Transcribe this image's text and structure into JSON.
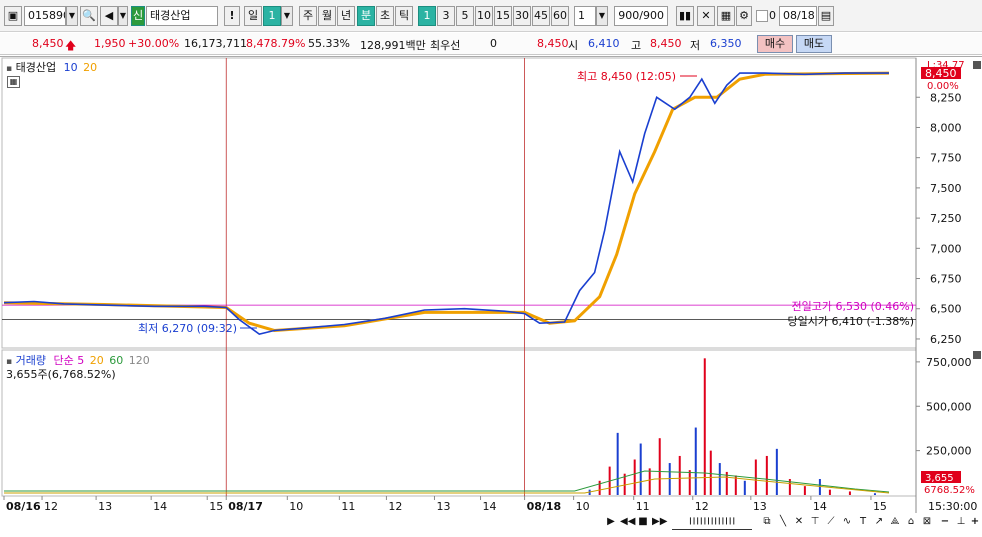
{
  "toolbar": {
    "code": "015890",
    "name": "태경산업",
    "name_badge": "신",
    "alert": "!",
    "period_day": "일",
    "period_value": "1",
    "week": "주",
    "month": "월",
    "year": "년",
    "minute": "분",
    "second": "초",
    "tick": "틱",
    "intervals": [
      "1",
      "3",
      "5",
      "10",
      "15",
      "30",
      "45",
      "60"
    ],
    "interval_count": "1",
    "bar_count": "900/900",
    "date": "08/18",
    "check_label": "0"
  },
  "quote": {
    "price": "8,450",
    "change": "1,950",
    "change_pct": "+30.00%",
    "volume": "16,173,711",
    "volume_ratio": "8,478.79%",
    "rate": "55.33%",
    "amount": "128,991백만",
    "priority_label": "최우선",
    "priority_value": "0",
    "ask": "8,450",
    "open_label": "시",
    "open": "6,410",
    "high_label": "고",
    "high": "8,450",
    "low_label": "저",
    "low": "6,350",
    "buy": "매수",
    "sell": "매도"
  },
  "price_pane": {
    "name": "태경산업",
    "ma1": "10",
    "ma2": "20",
    "high_note": "최고 8,450 (12:05)",
    "low_note": "최저 6,270 (09:32)",
    "prev_high_note": "전일고가 6,530 (0.46%)",
    "today_open_note": "당일시가 6,410 (-1.38%)",
    "limit_label": "L:34.77",
    "price_tag": "8,450",
    "pct_tag": "0.00%",
    "y_ticks": [
      "8,250",
      "8,000",
      "7,750",
      "7,500",
      "7,250",
      "7,000",
      "6,750",
      "6,500",
      "6,250"
    ]
  },
  "volume_pane": {
    "title": "거래량",
    "ma_label": "단순",
    "ma1": "5",
    "ma2": "20",
    "ma3": "60",
    "ma4": "120",
    "current": "3,655주(6,768.52%)",
    "y_ticks": [
      "750,000",
      "500,000",
      "250,000"
    ],
    "value_tag": "3,655",
    "pct_tag": "6768.52%"
  },
  "x_axis": {
    "labels": [
      "08/16",
      "12",
      "13",
      "14",
      "15",
      "08/17",
      "10",
      "11",
      "12",
      "13",
      "14",
      "08/18",
      "10",
      "11",
      "12",
      "13",
      "14",
      "15"
    ],
    "time": "15:30:00"
  },
  "colors": {
    "up": "#e0001b",
    "down": "#1a3fd0",
    "ma10": "#1a3fd0",
    "ma20": "#f0a000",
    "accent": "#2bb3a3",
    "prev_high": "#d000c0"
  },
  "chart_data": {
    "type": "line",
    "price_series": [
      {
        "t": 0,
        "v": 6550
      },
      {
        "t": 30,
        "v": 6560
      },
      {
        "t": 60,
        "v": 6540
      },
      {
        "t": 100,
        "v": 6530
      },
      {
        "t": 150,
        "v": 6520
      },
      {
        "t": 200,
        "v": 6520
      },
      {
        "t": 222,
        "v": 6510
      },
      {
        "t": 235,
        "v": 6410
      },
      {
        "t": 255,
        "v": 6290
      },
      {
        "t": 270,
        "v": 6320
      },
      {
        "t": 300,
        "v": 6340
      },
      {
        "t": 340,
        "v": 6370
      },
      {
        "t": 380,
        "v": 6420
      },
      {
        "t": 420,
        "v": 6490
      },
      {
        "t": 460,
        "v": 6500
      },
      {
        "t": 500,
        "v": 6480
      },
      {
        "t": 520,
        "v": 6460
      },
      {
        "t": 535,
        "v": 6380
      },
      {
        "t": 560,
        "v": 6390
      },
      {
        "t": 575,
        "v": 6650
      },
      {
        "t": 590,
        "v": 6800
      },
      {
        "t": 600,
        "v": 7150
      },
      {
        "t": 615,
        "v": 7800
      },
      {
        "t": 628,
        "v": 7550
      },
      {
        "t": 640,
        "v": 7950
      },
      {
        "t": 652,
        "v": 8250
      },
      {
        "t": 670,
        "v": 8150
      },
      {
        "t": 685,
        "v": 8250
      },
      {
        "t": 697,
        "v": 8400
      },
      {
        "t": 710,
        "v": 8200
      },
      {
        "t": 722,
        "v": 8350
      },
      {
        "t": 735,
        "v": 8450
      },
      {
        "t": 760,
        "v": 8450
      },
      {
        "t": 800,
        "v": 8440
      },
      {
        "t": 840,
        "v": 8450
      },
      {
        "t": 884,
        "v": 8450
      }
    ],
    "ma20_series": [
      {
        "t": 0,
        "v": 6550
      },
      {
        "t": 100,
        "v": 6535
      },
      {
        "t": 222,
        "v": 6510
      },
      {
        "t": 245,
        "v": 6380
      },
      {
        "t": 270,
        "v": 6320
      },
      {
        "t": 340,
        "v": 6360
      },
      {
        "t": 420,
        "v": 6470
      },
      {
        "t": 520,
        "v": 6470
      },
      {
        "t": 545,
        "v": 6380
      },
      {
        "t": 570,
        "v": 6400
      },
      {
        "t": 595,
        "v": 6600
      },
      {
        "t": 612,
        "v": 6950
      },
      {
        "t": 630,
        "v": 7450
      },
      {
        "t": 650,
        "v": 7800
      },
      {
        "t": 668,
        "v": 8150
      },
      {
        "t": 690,
        "v": 8250
      },
      {
        "t": 712,
        "v": 8250
      },
      {
        "t": 735,
        "v": 8400
      },
      {
        "t": 760,
        "v": 8440
      },
      {
        "t": 884,
        "v": 8450
      }
    ],
    "volume_bars": [
      {
        "t": 585,
        "v": 30000
      },
      {
        "t": 595,
        "v": 80000
      },
      {
        "t": 605,
        "v": 160000
      },
      {
        "t": 613,
        "v": 350000
      },
      {
        "t": 620,
        "v": 120000
      },
      {
        "t": 630,
        "v": 200000
      },
      {
        "t": 636,
        "v": 290000
      },
      {
        "t": 645,
        "v": 150000
      },
      {
        "t": 655,
        "v": 320000
      },
      {
        "t": 665,
        "v": 180000
      },
      {
        "t": 675,
        "v": 220000
      },
      {
        "t": 685,
        "v": 140000
      },
      {
        "t": 691,
        "v": 380000
      },
      {
        "t": 700,
        "v": 770000
      },
      {
        "t": 706,
        "v": 250000
      },
      {
        "t": 715,
        "v": 180000
      },
      {
        "t": 722,
        "v": 130000
      },
      {
        "t": 731,
        "v": 110000
      },
      {
        "t": 740,
        "v": 80000
      },
      {
        "t": 751,
        "v": 200000
      },
      {
        "t": 762,
        "v": 220000
      },
      {
        "t": 772,
        "v": 260000
      },
      {
        "t": 785,
        "v": 90000
      },
      {
        "t": 800,
        "v": 50000
      },
      {
        "t": 815,
        "v": 90000
      },
      {
        "t": 825,
        "v": 30000
      },
      {
        "t": 845,
        "v": 20000
      },
      {
        "t": 870,
        "v": 10000
      }
    ],
    "day_separators": [
      222,
      520
    ],
    "prev_high": 6530,
    "today_open": 6410,
    "ylim": [
      6200,
      8550
    ],
    "vol_max": 800000
  }
}
